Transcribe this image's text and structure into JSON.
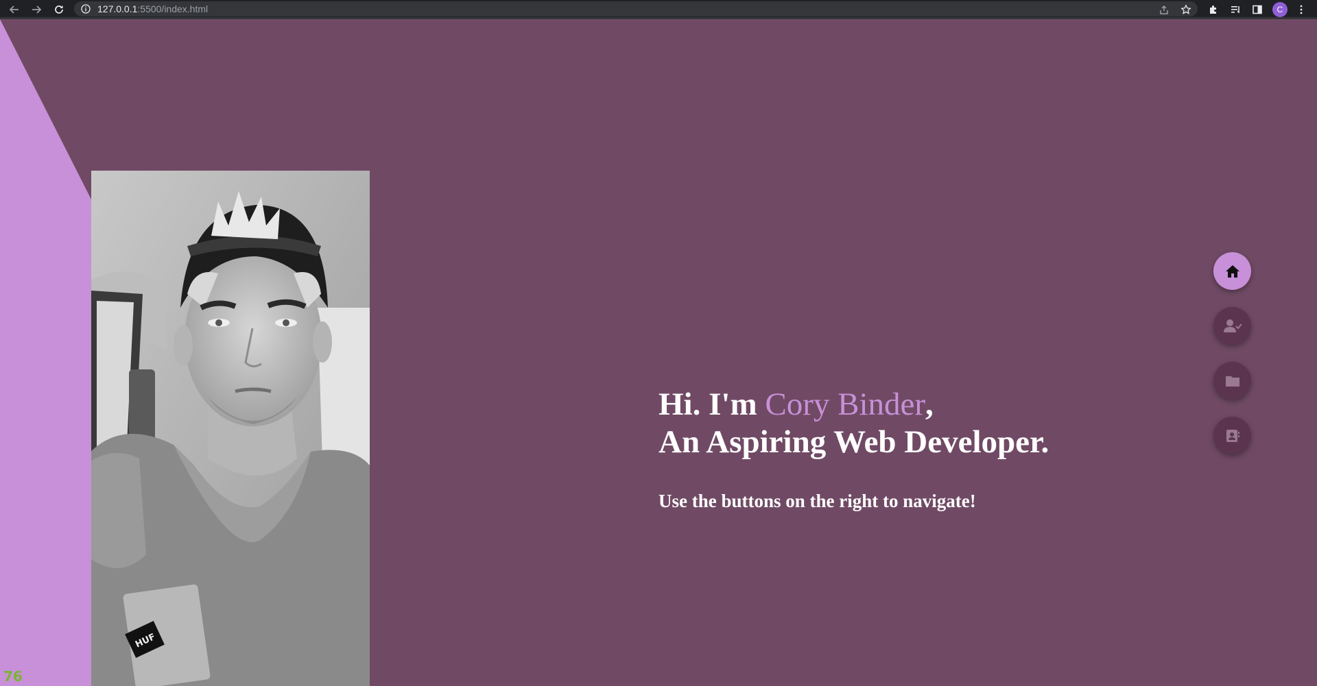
{
  "browser": {
    "url_host": "127.0.0.1",
    "url_rest": ":5500/index.html",
    "profile_initial": "C"
  },
  "hero": {
    "greeting": "Hi. I'm ",
    "name": "Cory Binder",
    "comma": ",",
    "tagline": "An Aspiring Web Developer.",
    "instruction": "Use the buttons on the right to navigate!"
  },
  "nav": {
    "items": [
      {
        "icon": "home-icon",
        "active": true
      },
      {
        "icon": "user-check-icon",
        "active": false
      },
      {
        "icon": "folder-icon",
        "active": false
      },
      {
        "icon": "contact-card-icon",
        "active": false
      }
    ]
  },
  "overlay": {
    "counter": "76"
  },
  "colors": {
    "background": "#704a64",
    "accent": "#c890d8",
    "nav_button": "#5b3550",
    "counter": "#7ab536"
  }
}
